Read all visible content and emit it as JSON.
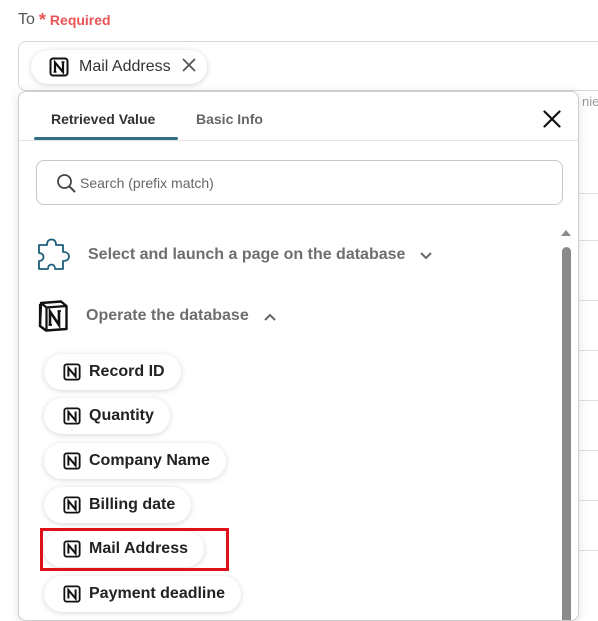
{
  "field": {
    "label": "To",
    "required_mark": "*",
    "required_text": "Required",
    "selected_chip": "Mail Address",
    "clipped_background_text": "nier"
  },
  "popup": {
    "tabs": [
      {
        "label": "Retrieved Value",
        "active": true
      },
      {
        "label": "Basic Info",
        "active": false
      }
    ],
    "search": {
      "placeholder": "Search (prefix match)",
      "value": ""
    },
    "sections": [
      {
        "title": "Select and launch a page on the database",
        "icon": "puzzle-icon",
        "expanded": false
      },
      {
        "title": "Operate the database",
        "icon": "notion-icon",
        "expanded": true
      }
    ],
    "items": [
      {
        "label": "Record ID",
        "highlighted": false
      },
      {
        "label": "Quantity",
        "highlighted": false
      },
      {
        "label": "Company Name",
        "highlighted": false
      },
      {
        "label": "Billing date",
        "highlighted": false
      },
      {
        "label": "Mail Address",
        "highlighted": true
      },
      {
        "label": "Payment deadline",
        "highlighted": false
      }
    ]
  },
  "colors": {
    "required": "#ea5455",
    "tab_underline": "#2f6f87",
    "highlight_border": "#e0101a",
    "scrollbar": "#8a8a8a"
  }
}
